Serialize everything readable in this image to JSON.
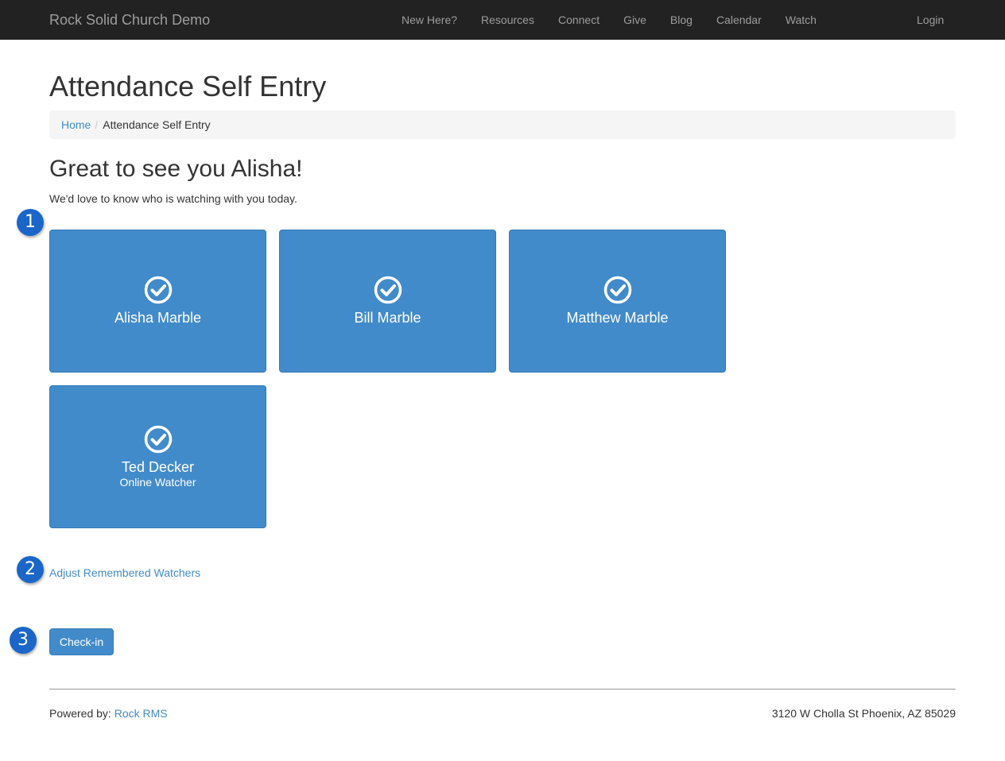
{
  "navbar": {
    "brand": "Rock Solid Church Demo",
    "links": [
      "New Here?",
      "Resources",
      "Connect",
      "Give",
      "Blog",
      "Calendar",
      "Watch"
    ],
    "login": "Login"
  },
  "page": {
    "title": "Attendance Self Entry",
    "breadcrumb": {
      "home": "Home",
      "separator": "/",
      "current": "Attendance Self Entry"
    },
    "greeting": "Great to see you Alisha!",
    "intro": "We'd love to know who is watching with you today."
  },
  "steps": [
    "1",
    "2",
    "3"
  ],
  "tiles": [
    {
      "name": "Alisha Marble",
      "subtitle": "",
      "selected": true,
      "icon": "check-circle-icon"
    },
    {
      "name": "Bill Marble",
      "subtitle": "",
      "selected": true,
      "icon": "check-circle-icon"
    },
    {
      "name": "Matthew Marble",
      "subtitle": "",
      "selected": true,
      "icon": "check-circle-icon"
    },
    {
      "name": "Ted Decker",
      "subtitle": "Online Watcher",
      "selected": true,
      "icon": "check-circle-icon"
    }
  ],
  "actions": {
    "adjust_link": "Adjust Remembered Watchers",
    "checkin_label": "Check-in"
  },
  "footer": {
    "powered_by_label": "Powered by:",
    "powered_by_link": "Rock RMS",
    "address": "3120 W Cholla St Phoenix, AZ 85029"
  },
  "colors": {
    "navbar_bg": "#222222",
    "primary": "#428bca",
    "step_badge": "#1a66c9"
  }
}
